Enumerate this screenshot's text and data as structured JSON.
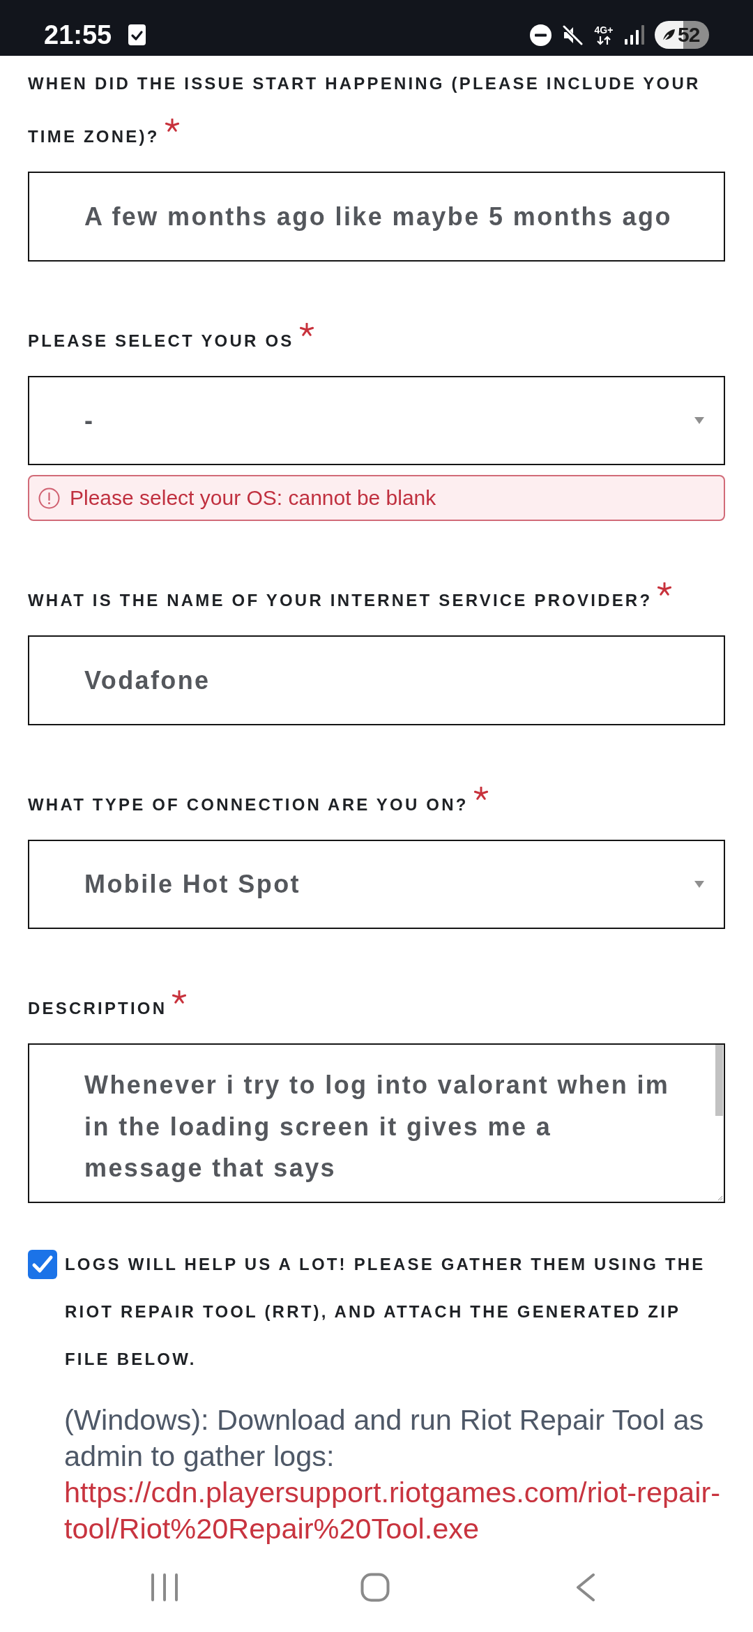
{
  "status_bar": {
    "time": "21:55",
    "network": "4G+",
    "battery": "52"
  },
  "fields": [
    {
      "kind": "text",
      "label": "WHEN DID THE ISSUE START HAPPENING (PLEASE INCLUDE YOUR TIME ZONE)?",
      "required": true,
      "value": "A few months ago like maybe 5 months ago"
    },
    {
      "kind": "select",
      "label": "PLEASE SELECT YOUR OS",
      "required": true,
      "value": "-",
      "error": "Please select your OS: cannot be blank"
    },
    {
      "kind": "text",
      "label": "WHAT IS THE NAME OF YOUR INTERNET SERVICE PROVIDER?",
      "required": true,
      "value": "Vodafone"
    },
    {
      "kind": "select",
      "label": "WHAT TYPE OF CONNECTION ARE YOU ON?",
      "required": true,
      "value": "Mobile Hot Spot"
    },
    {
      "kind": "textarea",
      "label": "DESCRIPTION",
      "required": true,
      "value": "Whenever i try to log into valorant when im in the loading screen it gives me a\nmessage that says"
    }
  ],
  "logs_consent": {
    "checked": true,
    "label": "LOGS WILL HELP US A LOT! PLEASE GATHER THEM USING THE RIOT REPAIR TOOL (RRT), AND ATTACH THE GENERATED ZIP FILE BELOW."
  },
  "instructions": {
    "text": "(Windows): Download and run Riot Repair Tool as admin to gather logs:",
    "link": "https://cdn.playersupport.riotgames.com/riot-repair-tool/Riot%20Repair%20Tool.exe"
  }
}
